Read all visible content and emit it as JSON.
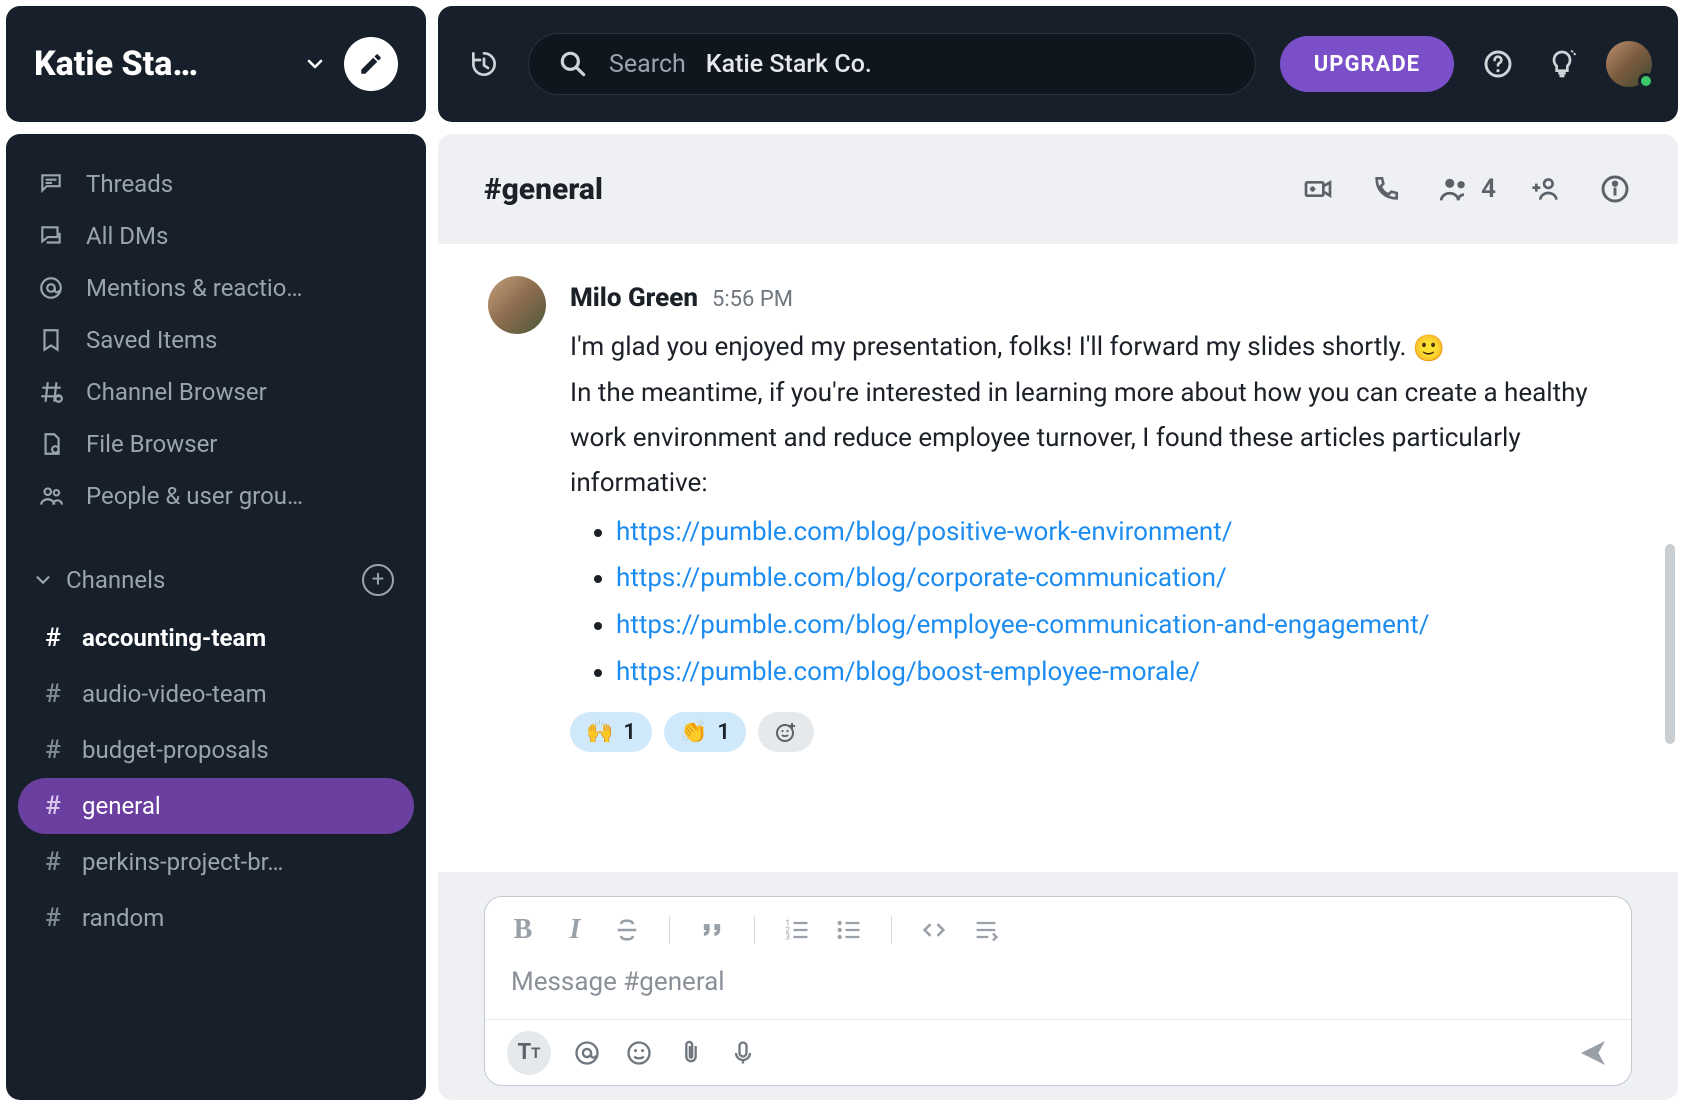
{
  "workspace": {
    "title": "Katie Sta…",
    "search_name": "Katie Stark Co."
  },
  "topbar": {
    "search_prefix": "Search",
    "upgrade_label": "UPGRADE"
  },
  "sidebar": {
    "nav": [
      {
        "id": "threads",
        "label": "Threads"
      },
      {
        "id": "all-dms",
        "label": "All DMs"
      },
      {
        "id": "mentions",
        "label": "Mentions & reactio…"
      },
      {
        "id": "saved",
        "label": "Saved Items"
      },
      {
        "id": "channel-browser",
        "label": "Channel Browser"
      },
      {
        "id": "file-browser",
        "label": "File Browser"
      },
      {
        "id": "people",
        "label": "People & user grou…"
      }
    ],
    "channels_header": "Channels",
    "channels": [
      {
        "name": "accounting-team",
        "bold": true,
        "active": false
      },
      {
        "name": "audio-video-team",
        "bold": false,
        "active": false
      },
      {
        "name": "budget-proposals",
        "bold": false,
        "active": false
      },
      {
        "name": "general",
        "bold": false,
        "active": true
      },
      {
        "name": "perkins-project-br…",
        "bold": false,
        "active": false
      },
      {
        "name": "random",
        "bold": false,
        "active": false
      }
    ]
  },
  "channel": {
    "title": "#general",
    "member_count": "4"
  },
  "message": {
    "author": "Milo Green",
    "time": "5:56 PM",
    "line1": "I'm glad you enjoyed my presentation, folks! I'll forward my slides shortly.",
    "emoji": "🙂",
    "line2": "In the meantime, if you're interested in learning more about how you can create a healthy work environment and reduce employee turnover, I found these articles particularly informative:",
    "links": [
      "https://pumble.com/blog/positive-work-environment/",
      "https://pumble.com/blog/corporate-communication/",
      "https://pumble.com/blog/employee-communication-and-engagement/",
      "https://pumble.com/blog/boost-employee-morale/"
    ],
    "reactions": [
      {
        "emoji": "🙌",
        "count": "1"
      },
      {
        "emoji": "👏",
        "count": "1"
      }
    ]
  },
  "composer": {
    "placeholder": "Message #general"
  }
}
